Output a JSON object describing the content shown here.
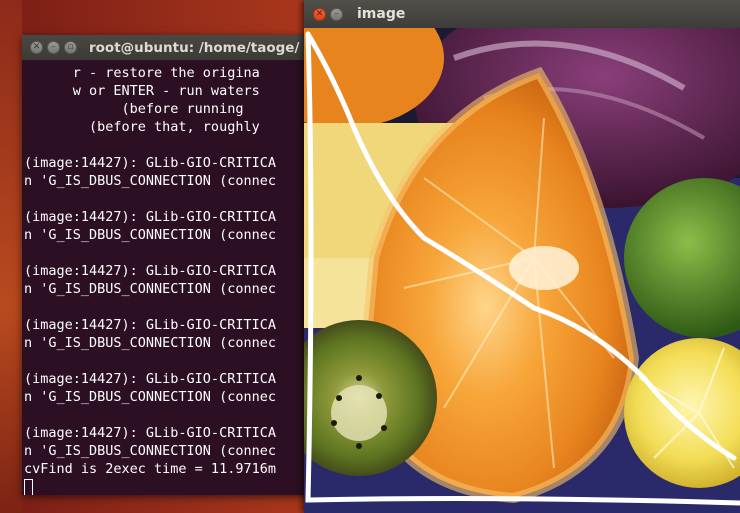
{
  "terminal": {
    "title": "root@ubuntu: /home/taoge/",
    "lines": [
      "      r - restore the origina",
      "      w or ENTER - run waters",
      "            (before running",
      "        (before that, roughly",
      "",
      "(image:14427): GLib-GIO-CRITICA",
      "n 'G_IS_DBUS_CONNECTION (connec",
      "",
      "(image:14427): GLib-GIO-CRITICA",
      "n 'G_IS_DBUS_CONNECTION (connec",
      "",
      "(image:14427): GLib-GIO-CRITICA",
      "n 'G_IS_DBUS_CONNECTION (connec",
      "",
      "(image:14427): GLib-GIO-CRITICA",
      "n 'G_IS_DBUS_CONNECTION (connec",
      "",
      "(image:14427): GLib-GIO-CRITICA",
      "n 'G_IS_DBUS_CONNECTION (connec",
      "",
      "(image:14427): GLib-GIO-CRITICA",
      "n 'G_IS_DBUS_CONNECTION (connec",
      "cvFind is 2exec time = 11.9716m"
    ]
  },
  "image_window": {
    "title": "image",
    "content": "fruit-photo-with-white-markers"
  },
  "icons": {
    "close": "close-icon",
    "minimize": "minimize-icon",
    "maximize": "maximize-icon"
  },
  "colors": {
    "terminal_bg": "#2c0f22",
    "titlebar": "#3d3c38",
    "close_button": "#e2501f"
  }
}
